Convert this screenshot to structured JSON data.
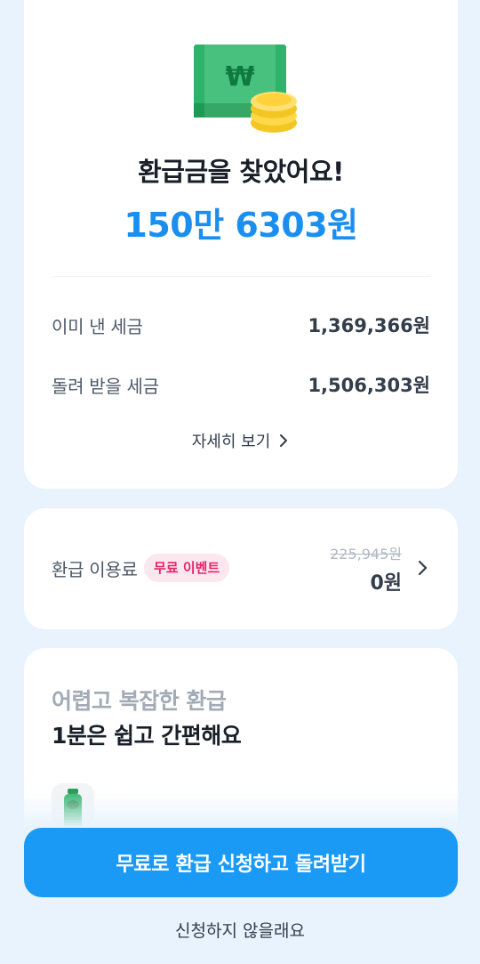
{
  "refund": {
    "title": "환급금을 찾았어요!",
    "amount": "150만 6303원",
    "rows": [
      {
        "label": "이미 낸 세금",
        "value": "1,369,366원"
      },
      {
        "label": "돌려 받을 세금",
        "value": "1,506,303원"
      }
    ],
    "detail_label": "자세히 보기",
    "hero_icon": "money-bill-coins-icon",
    "hero_symbol": "₩"
  },
  "fee": {
    "label": "환급 이용료",
    "badge": "무료 이벤트",
    "original_price": "225,945원",
    "price": "0원"
  },
  "promo": {
    "line1": "어렵고 복잡한 환급",
    "line2": "1분은 쉽고 간편해요",
    "icon": "green-bottle-icon"
  },
  "actions": {
    "cta_label": "무료로 환급 신청하고 돌려받기",
    "decline_label": "신청하지 않을래요"
  },
  "colors": {
    "background": "#e8f3fd",
    "accent": "#1b8ff0",
    "button": "#1a9af5",
    "badge_bg": "#fde7ef",
    "badge_text": "#e4256a"
  }
}
